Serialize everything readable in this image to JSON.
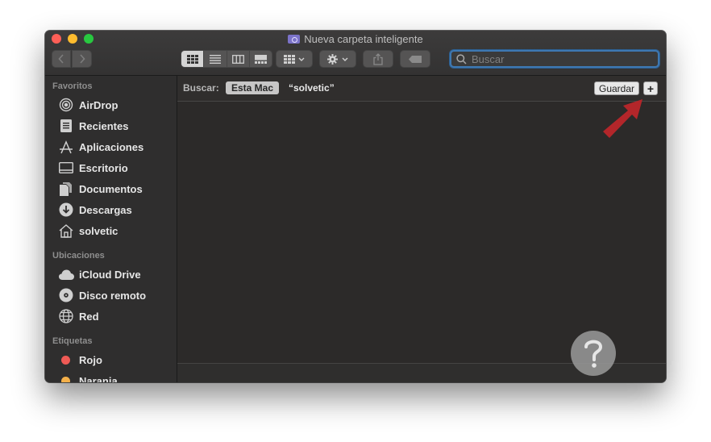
{
  "window": {
    "title": "Nueva carpeta inteligente"
  },
  "toolbar": {
    "search_placeholder": "Buscar",
    "icons": [
      "chevron-left-icon",
      "chevron-right-icon",
      "icon-view-icon",
      "list-view-icon",
      "column-view-icon",
      "gallery-view-icon",
      "group-icon",
      "gear-icon",
      "share-icon",
      "tag-icon",
      "search-icon"
    ]
  },
  "sidebar": {
    "sections": [
      {
        "title": "Favoritos",
        "items": [
          {
            "label": "AirDrop",
            "icon": "airdrop-icon"
          },
          {
            "label": "Recientes",
            "icon": "recents-icon"
          },
          {
            "label": "Aplicaciones",
            "icon": "applications-icon"
          },
          {
            "label": "Escritorio",
            "icon": "desktop-icon"
          },
          {
            "label": "Documentos",
            "icon": "documents-icon"
          },
          {
            "label": "Descargas",
            "icon": "downloads-icon"
          },
          {
            "label": "solvetic",
            "icon": "home-icon"
          }
        ]
      },
      {
        "title": "Ubicaciones",
        "items": [
          {
            "label": "iCloud Drive",
            "icon": "cloud-icon"
          },
          {
            "label": "Disco remoto",
            "icon": "disc-icon"
          },
          {
            "label": "Red",
            "icon": "network-icon"
          }
        ]
      },
      {
        "title": "Etiquetas",
        "items": [
          {
            "label": "Rojo",
            "color": "#ef5a55"
          },
          {
            "label": "Naranja",
            "color": "#f4b04a"
          }
        ]
      }
    ]
  },
  "search_scope": {
    "label": "Buscar:",
    "active_scope": "Esta Mac",
    "query_scope": "“solvetic”",
    "save_label": "Guardar",
    "add_label": "+"
  },
  "colors": {
    "accent_search_ring": "#3e78b1",
    "annotation_arrow": "#b3262a",
    "window_bg": "#2b2b2b",
    "sidebar_bg": "#2f2e2e"
  }
}
